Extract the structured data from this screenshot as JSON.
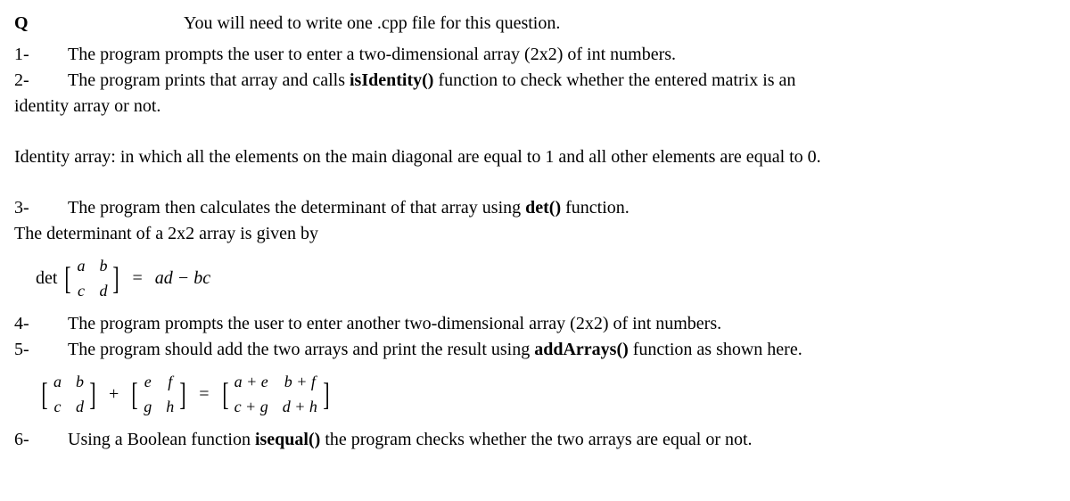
{
  "header": {
    "q_label": "Q",
    "instruction": "You will need to write one .cpp file for this question."
  },
  "items": {
    "n1": {
      "label": "1-",
      "text": "The program prompts the user to enter a two-dimensional array (2x2) of int numbers."
    },
    "n2": {
      "label": "2-",
      "text_before": "The program prints that array and calls ",
      "bold": "isIdentity()",
      "text_after": " function to check whether the entered matrix is an"
    },
    "n2_cont": "identity array or not.",
    "identity_def": "Identity array: in which all the elements on the main diagonal are equal to 1 and all other elements are equal to 0.",
    "n3": {
      "label": "3-",
      "text_before": "The program then calculates the determinant of that array using ",
      "bold": "det()",
      "text_after": " function."
    },
    "n3_cont": "The determinant of a 2x2 array is given by",
    "n4": {
      "label": "4-",
      "text": "The program prompts the user to enter another two-dimensional array (2x2) of int numbers."
    },
    "n5": {
      "label": "5-",
      "text_before": "The program should add the two arrays and print the result using ",
      "bold": "addArrays()",
      "text_after": " function as shown here."
    },
    "n6": {
      "label": "6-",
      "text_before": "Using a Boolean function ",
      "bold": "isequal()",
      "text_after": " the program checks whether the two arrays are equal or not."
    }
  },
  "math": {
    "det_label": "det",
    "m1": {
      "a": "a",
      "b": "b",
      "c": "c",
      "d": "d"
    },
    "eq": "=",
    "plus": "+",
    "det_rhs": "ad − bc",
    "m2": {
      "a": "e",
      "b": "f",
      "c": "g",
      "d": "h"
    },
    "m3": {
      "a": "a + e",
      "b": "b + f",
      "c": "c + g",
      "d": "d + h"
    }
  }
}
